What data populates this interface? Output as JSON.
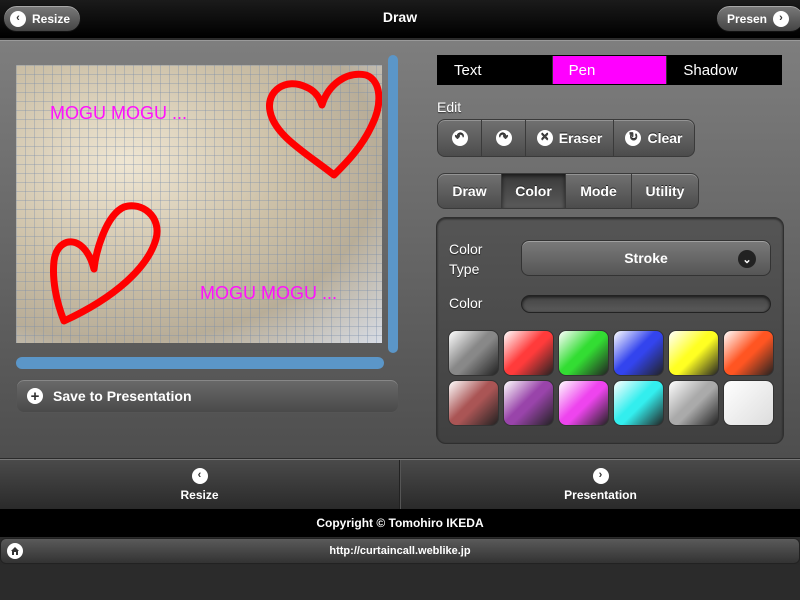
{
  "header": {
    "title": "Draw",
    "left_button": "Resize",
    "right_button": "Presen"
  },
  "canvas": {
    "texts": [
      "MOGU MOGU ...",
      "MOGU MOGU ..."
    ]
  },
  "save_button": "Save to Presentation",
  "top_tabs": [
    {
      "label": "Text",
      "active": false
    },
    {
      "label": "Pen",
      "active": true
    },
    {
      "label": "Shadow",
      "active": false
    }
  ],
  "edit": {
    "label": "Edit",
    "eraser": "Eraser",
    "clear": "Clear"
  },
  "mode_tabs": [
    {
      "label": "Draw",
      "active": false
    },
    {
      "label": "Color",
      "active": true
    },
    {
      "label": "Mode",
      "active": false
    },
    {
      "label": "Utility",
      "active": false
    }
  ],
  "color_panel": {
    "type_label": "Color Type",
    "type_value": "Stroke",
    "color_label": "Color",
    "swatches": [
      "#888888",
      "#ff3b3b",
      "#33dd33",
      "#3344ee",
      "#ffff22",
      "#ff5522",
      "#aa5555",
      "#9944aa",
      "#ee44ee",
      "#33eeee",
      "#aaaaaa",
      "#ffffff"
    ]
  },
  "bottom_nav": {
    "left": "Resize",
    "right": "Presentation"
  },
  "footer": {
    "copyright": "Copyright © Tomohiro IKEDA",
    "url": "http://curtaincall.weblike.jp"
  },
  "colors": {
    "accent_pen": "#ff00ff",
    "scrollbar": "#5b96c8",
    "drawing_red": "#ff0000"
  }
}
